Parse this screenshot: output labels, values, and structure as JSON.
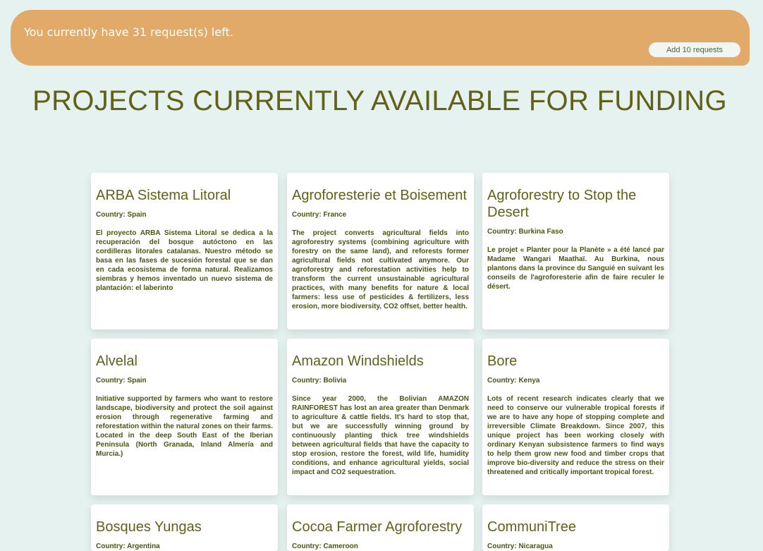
{
  "banner": {
    "message": "You currently have 31 request(s) left.",
    "button_label": "Add 10 requests",
    "background_color": "#e2aa68"
  },
  "page_title": "PROJECTS CURRENTLY AVAILABLE FOR FUNDING",
  "colors": {
    "title": "#626118",
    "page_background": "#e5f2ef"
  },
  "projects": [
    {
      "title": "ARBA Sistema Litoral",
      "country": "Country: Spain",
      "description": "El proyecto ARBA Sistema Litoral se dedica a la recuperación del bosque autóctono en las cordilleras litorales catalanas. Nuestro método se basa en las fases de sucesión forestal que se dan en cada ecosistema de forma natural. Realizamos siembras y hemos inventado un nuevo sistema de plantación: el laberinto"
    },
    {
      "title": "Agroforesterie et Boisement",
      "country": "Country: France",
      "description": "The project converts agricultural fields into agroforestry systems (combining agriculture with forestry on the same land), and reforests former agricultural fields not cultivated anymore. Our agroforestry and reforestation activities help to transform the current unsustainable agricultural practices, with many benefits for nature & local farmers: less use of pesticides & fertilizers, less erosion, more biodiversity, CO2 offset, better health."
    },
    {
      "title": "Agroforestry to Stop the Desert",
      "country": "Country: Burkina Faso",
      "description": "Le projet « Planter pour la Planète » a été lancé par Madame Wangari Maathaï. Au Burkina, nous plantons dans la province du Sanguié en suivant les conseils de l'agroforesterie afin de faire reculer le désert."
    },
    {
      "title": "Alvelal",
      "country": "Country: Spain",
      "description": "Initiative supported by farmers who want to restore landscape, biodiversity and protect the soil against erosion through regenerative farming and reforestation within the natural zones on their farms. Located in the deep South East of the Iberian Peninsula (North Granada, Inland Almería and Murcia.)"
    },
    {
      "title": "Amazon Windshields",
      "country": "Country: Bolivia",
      "description": "Since year 2000, the Bolivian AMAZON RAINFOREST has lost an area greater than Denmark to agriculture & cattle fields. It's hard to stop that, but we are successfully winning ground by continuously planting thick tree windshields between agricultural fields that have the capacity to stop erosion, restore the forest, wild life, humidity conditions, and enhance agricultural yields, social impact and CO2 sequestration."
    },
    {
      "title": "Bore",
      "country": "Country: Kenya",
      "description": "Lots of recent research indicates clearly that we need to conserve our vulnerable tropical forests if we are to have any hope of stopping complete and irreversible Climate Breakdown. Since 2007, this unique project has been working closely with ordinary Kenyan subsistence farmers to find ways to help them grow new food and timber crops that improve bio-diversity and reduce the stress on their threatened and critically important tropical forest."
    },
    {
      "title": "Bosques Yungas",
      "country": "Country: Argentina",
      "description": ""
    },
    {
      "title": "Cocoa Farmer Agroforestry",
      "country": "Country: Cameroon",
      "description": ""
    },
    {
      "title": "CommuniTree",
      "country": "Country: Nicaragua",
      "description": ""
    }
  ]
}
